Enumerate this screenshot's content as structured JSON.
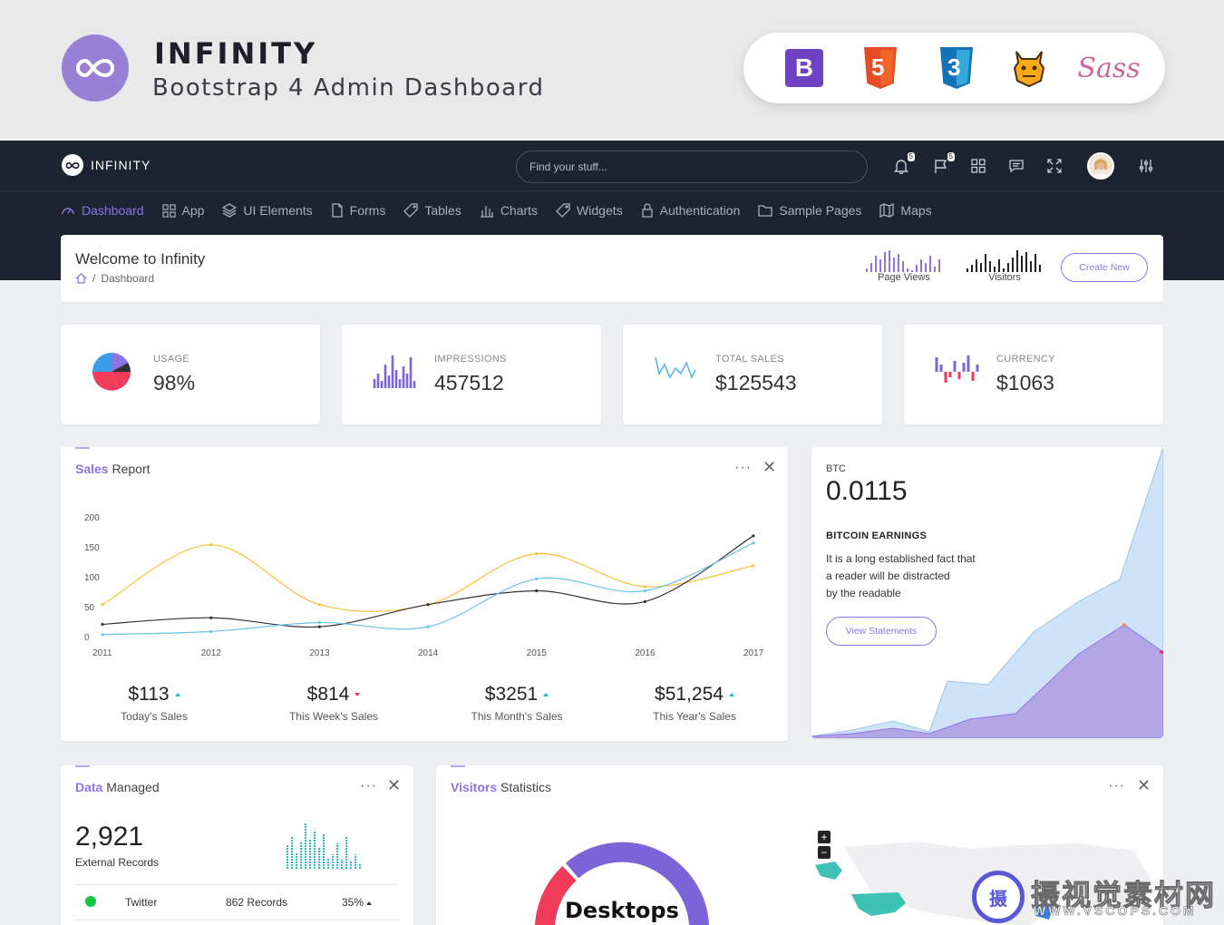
{
  "banner": {
    "title": "INFINITY",
    "subtitle": "Bootstrap 4 Admin Dashboard",
    "tech_icons": [
      "bootstrap-icon",
      "html5-icon",
      "css3-icon",
      "grunt-icon",
      "sass-icon"
    ],
    "bootstrap_letter": "B",
    "html_letter": "5",
    "css_letter": "3",
    "sass_word": "Sass"
  },
  "topbar": {
    "brand": "INFINITY",
    "search_placeholder": "Find your stuff...",
    "notifications_count": "5",
    "flags_count": "5"
  },
  "nav": [
    {
      "label": "Dashboard",
      "icon": "dashboard-icon",
      "active": true
    },
    {
      "label": "App",
      "icon": "grid-icon"
    },
    {
      "label": "UI Elements",
      "icon": "layers-icon"
    },
    {
      "label": "Forms",
      "icon": "file-icon"
    },
    {
      "label": "Tables",
      "icon": "tag-icon"
    },
    {
      "label": "Charts",
      "icon": "bar-chart-icon"
    },
    {
      "label": "Widgets",
      "icon": "tag-icon"
    },
    {
      "label": "Authentication",
      "icon": "lock-icon"
    },
    {
      "label": "Sample Pages",
      "icon": "folder-icon"
    },
    {
      "label": "Maps",
      "icon": "map-icon"
    }
  ],
  "welcome": {
    "title": "Welcome to Infinity",
    "crumb_sep": "/",
    "crumb": "Dashboard",
    "page_views_label": "Page Views",
    "visitors_label": "Visitors",
    "create_label": "Create New"
  },
  "stats": [
    {
      "label": "USAGE",
      "value": "98%"
    },
    {
      "label": "IMPRESSIONS",
      "value": "457512"
    },
    {
      "label": "TOTAL SALES",
      "value": "$125543"
    },
    {
      "label": "CURRENCY",
      "value": "$1063"
    }
  ],
  "sales": {
    "title_bold": "Sales",
    "title_rest": " Report",
    "dots": "···",
    "close": "✕",
    "summary": [
      {
        "value": "$113",
        "label": "Today's Sales",
        "trend": "up"
      },
      {
        "value": "$814",
        "label": "This Week's Sales",
        "trend": "down"
      },
      {
        "value": "$3251",
        "label": "This Month's Sales",
        "trend": "up"
      },
      {
        "value": "$51,254",
        "label": "This Year's Sales",
        "trend": "up"
      }
    ]
  },
  "chart_data": {
    "type": "line",
    "x": [
      "2011",
      "2012",
      "2013",
      "2014",
      "2015",
      "2016",
      "2017"
    ],
    "ylim": [
      0,
      200
    ],
    "yticks": [
      "200",
      "150",
      "100",
      "50",
      "0"
    ],
    "series": [
      {
        "color": "#f7c13b",
        "values": [
          55,
          155,
          55,
          55,
          140,
          85,
          120
        ]
      },
      {
        "color": "#333333",
        "values": [
          22,
          33,
          18,
          55,
          78,
          60,
          170
        ]
      },
      {
        "color": "#6cc2e9",
        "values": [
          5,
          10,
          25,
          18,
          98,
          78,
          158
        ]
      }
    ]
  },
  "btc": {
    "label": "BTC",
    "value": "0.0115",
    "heading": "BITCOIN EARNINGS",
    "text_lines": [
      "It is a long established fact that",
      "a reader will be distracted",
      "by the readable"
    ],
    "button": "View Statements"
  },
  "data_managed": {
    "title_bold": "Data",
    "title_rest": " Managed",
    "dots": "···",
    "close": "✕",
    "count": "2,921",
    "count_label": "External Records",
    "row": {
      "name": "Twitter",
      "records": "862 Records",
      "percent": "35%"
    }
  },
  "visitors": {
    "title_bold": "Visitors",
    "title_rest": " Statistics",
    "dots": "···",
    "close": "✕",
    "donut_label": "Desktops",
    "zoom_in": "+",
    "zoom_out": "−"
  },
  "watermark": {
    "text": "摄视觉素材网",
    "url": "WWW.VSCOPS.COM",
    "logo_char": "摄"
  },
  "colors": {
    "accent": "#8e74e2",
    "dark": "#1c2331",
    "yellow": "#f7c13b",
    "blue": "#6cc2e9",
    "red": "#f03b5b",
    "teal": "#2bbcaa"
  }
}
